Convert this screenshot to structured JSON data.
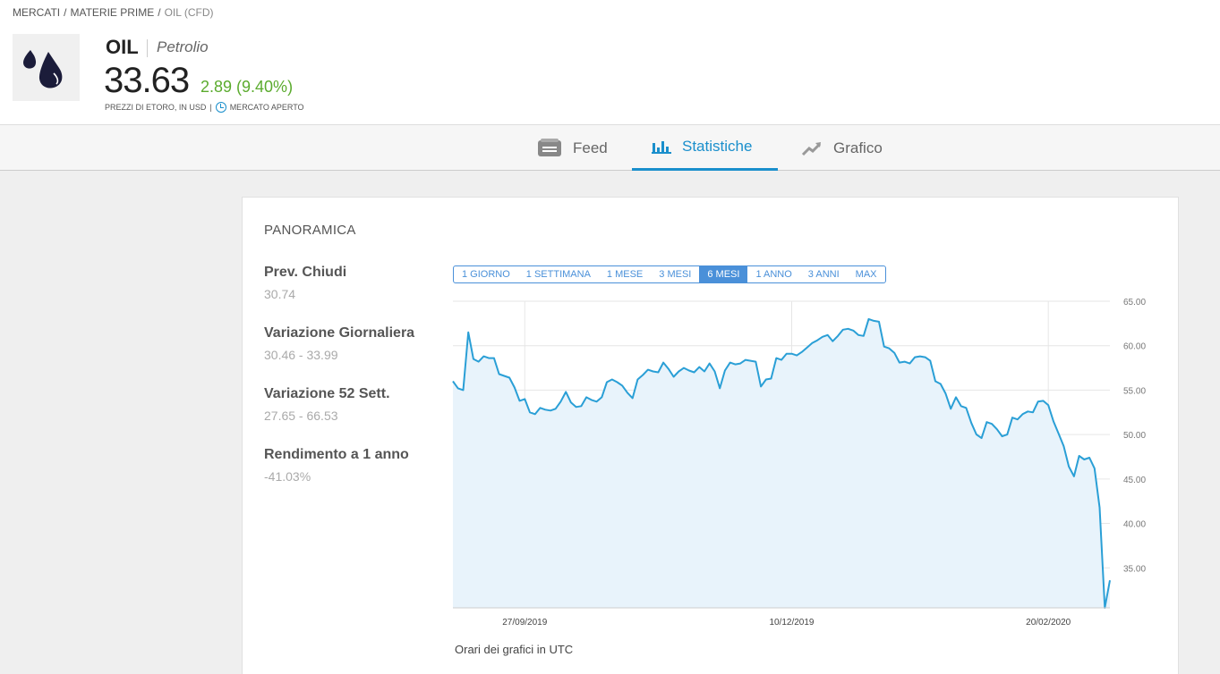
{
  "breadcrumb": {
    "markets": "MERCATI",
    "commodities": "MATERIE PRIME",
    "current": "OIL (CFD)"
  },
  "asset": {
    "symbol": "OIL",
    "name": "Petrolio",
    "price": "33.63",
    "change": "2.89 (9.40%)",
    "price_info": "PREZZI DI ETORO, IN USD",
    "market_status": "MERCATO APERTO"
  },
  "tabs": {
    "feed": "Feed",
    "stats": "Statistiche",
    "chart": "Grafico"
  },
  "overview": {
    "title": "PANORAMICA",
    "stats": [
      {
        "label": "Prev. Chiudi",
        "value": "30.74"
      },
      {
        "label": "Variazione Giornaliera",
        "value": "30.46 - 33.99"
      },
      {
        "label": "Variazione 52 Sett.",
        "value": "27.65 - 66.53"
      },
      {
        "label": "Rendimento a 1 anno",
        "value": "-41.03%"
      }
    ],
    "ranges": [
      "1 GIORNO",
      "1 SETTIMANA",
      "1 MESE",
      "3 MESI",
      "6 MESI",
      "1 ANNO",
      "3 ANNI",
      "MAX"
    ],
    "selected_range": "6 MESI",
    "timezone_note": "Orari dei grafici in UTC"
  },
  "colors": {
    "accent": "#1a8fcc",
    "positive": "#5bab2e",
    "line": "#2a9fd6",
    "fill": "#e8f3fb"
  },
  "chart_data": {
    "type": "area",
    "ylim": [
      30.5,
      65
    ],
    "yticks": [
      35,
      40,
      45,
      50,
      55,
      60,
      65
    ],
    "ytick_labels": [
      "35.00",
      "40.00",
      "45.00",
      "50.00",
      "55.00",
      "60.00",
      "65.00"
    ],
    "xticks": [
      {
        "index": 14,
        "label": "27/09/2019"
      },
      {
        "index": 66,
        "label": "10/12/2019"
      },
      {
        "index": 116,
        "label": "20/02/2020"
      }
    ],
    "values": [
      56.0,
      55.2,
      55.0,
      61.5,
      58.5,
      58.2,
      58.8,
      58.6,
      58.6,
      56.8,
      56.6,
      56.4,
      55.3,
      53.8,
      54.0,
      52.5,
      52.3,
      53.0,
      52.8,
      52.7,
      52.9,
      53.7,
      54.8,
      53.6,
      53.1,
      53.2,
      54.2,
      53.9,
      53.7,
      54.2,
      55.9,
      56.2,
      55.9,
      55.5,
      54.7,
      54.1,
      56.2,
      56.7,
      57.3,
      57.1,
      57.0,
      58.1,
      57.4,
      56.5,
      57.1,
      57.5,
      57.2,
      57.0,
      57.6,
      57.1,
      58.0,
      57.1,
      55.2,
      57.2,
      58.1,
      57.9,
      58.0,
      58.4,
      58.3,
      58.2,
      55.4,
      56.2,
      56.3,
      58.6,
      58.4,
      59.1,
      59.1,
      58.9,
      59.3,
      59.8,
      60.3,
      60.6,
      61.0,
      61.2,
      60.5,
      61.1,
      61.8,
      61.9,
      61.7,
      61.2,
      61.1,
      63.0,
      62.8,
      62.7,
      59.9,
      59.7,
      59.2,
      58.1,
      58.2,
      58.0,
      58.7,
      58.8,
      58.7,
      58.3,
      56.0,
      55.7,
      54.6,
      52.9,
      54.2,
      53.2,
      53.0,
      51.3,
      50.0,
      49.6,
      51.4,
      51.2,
      50.6,
      49.8,
      50.0,
      51.9,
      51.7,
      52.3,
      52.6,
      52.5,
      53.7,
      53.8,
      53.3,
      51.5,
      50.1,
      48.7,
      46.4,
      45.3,
      47.6,
      47.2,
      47.4,
      46.2,
      41.8,
      30.5,
      33.6
    ]
  }
}
